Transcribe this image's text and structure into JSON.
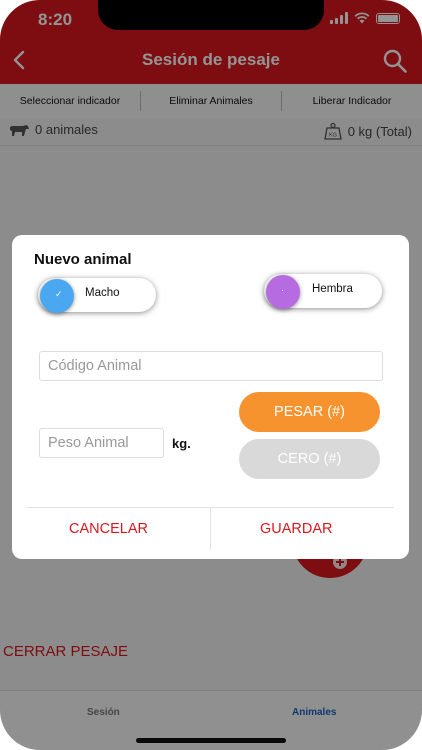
{
  "status_bar": {
    "time": "8:20"
  },
  "nav": {
    "title": "Sesión de pesaje",
    "back_icon": "chevron-left-icon",
    "search_icon": "search-icon"
  },
  "toolbar": {
    "select_indicator": "Seleccionar indicador",
    "delete_animals": "Eliminar Animales",
    "release_indicator": "Liberar Indicador"
  },
  "summary": {
    "animals": "0 animales",
    "weight": "0 kg (Total)",
    "kg_icon_label": "KG"
  },
  "close_session": "CERRAR PESAJE",
  "tabs": [
    {
      "label": "Sesión",
      "active": false
    },
    {
      "label": "Animales",
      "active": true
    }
  ],
  "dialog": {
    "title": "Nuevo animal",
    "male_label": "Macho",
    "female_label": "Hembra",
    "code_placeholder": "Código Animal",
    "weight_placeholder": "Peso Animal",
    "unit": "kg.",
    "weigh_button": "PESAR (#)",
    "zero_button": "CERO (#)",
    "cancel_button": "CANCELAR",
    "save_button": "GUARDAR"
  },
  "colors": {
    "brand_red": "#d7181e",
    "male_blue": "#4aa8f0",
    "female_purple": "#b76be0",
    "weigh_orange": "#f7932f",
    "zero_gray": "#d9d9d9",
    "tab_active": "#1f5fbf",
    "tab_inactive": "#777777"
  }
}
